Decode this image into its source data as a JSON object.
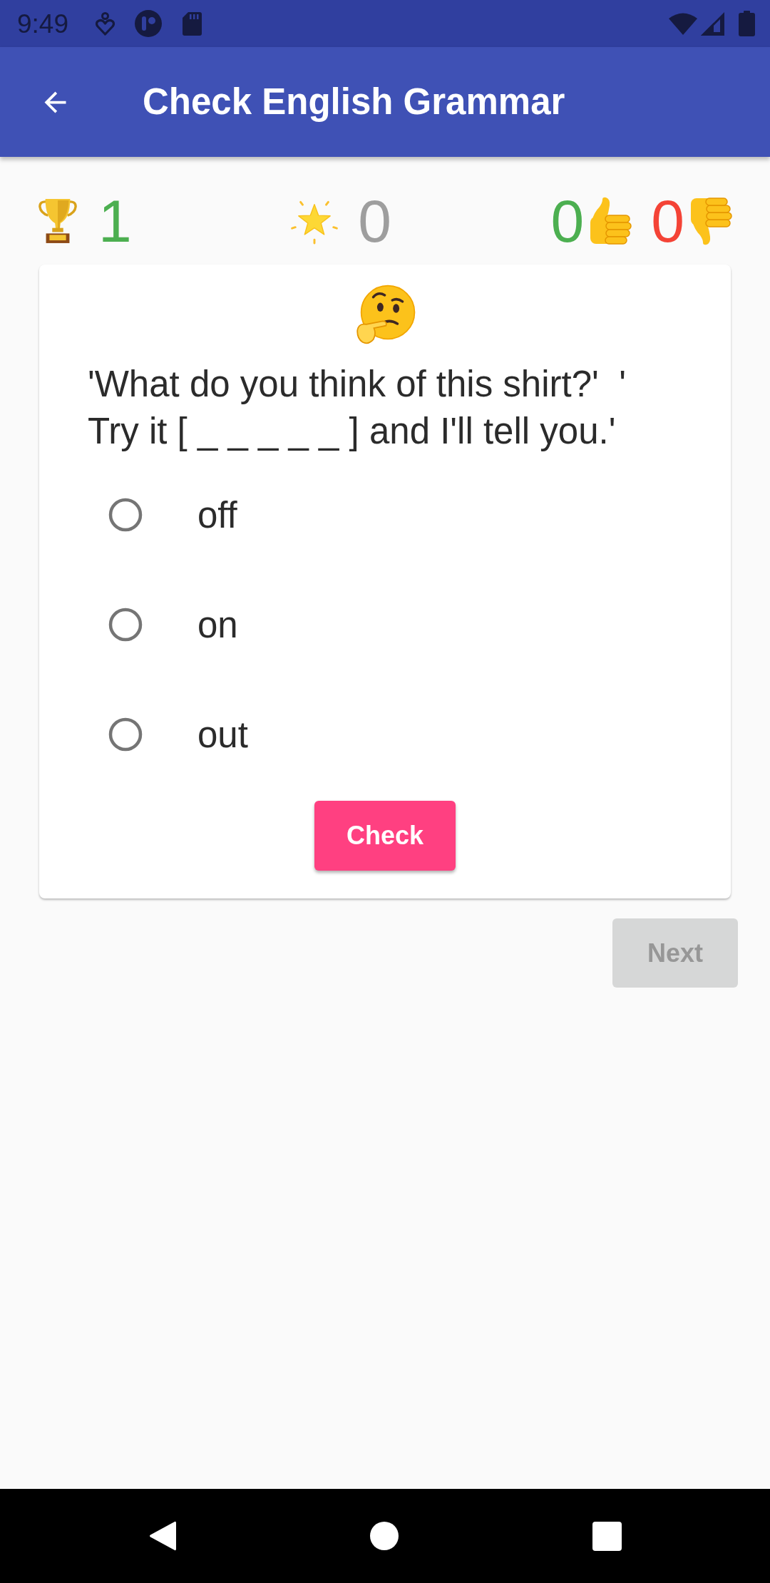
{
  "status_bar": {
    "time": "9:49"
  },
  "app_bar": {
    "title": "Check English Grammar"
  },
  "scores": [
    {
      "items": [
        {
          "kind": "trophies",
          "value": "1",
          "color": "#4caf50"
        }
      ]
    },
    {
      "items": [
        {
          "kind": "stars",
          "value": "0",
          "color": "#9e9e9e"
        }
      ]
    },
    {
      "items": [
        {
          "kind": "correct",
          "value": "0",
          "color": "#4caf50"
        },
        {
          "kind": "wrong",
          "value": "0",
          "color": "#f44336"
        }
      ]
    }
  ],
  "question": {
    "text": "'What do you think of this shirt?'  ' Try it [ _ _ _ _ _ ] and I'll tell you.'",
    "options": [
      {
        "label": "off",
        "selected": false
      },
      {
        "label": "on",
        "selected": false
      },
      {
        "label": "out",
        "selected": false
      }
    ]
  },
  "check_button": {
    "label": "Check",
    "disabled": false
  },
  "next_button": {
    "label": "Next",
    "disabled": true
  }
}
